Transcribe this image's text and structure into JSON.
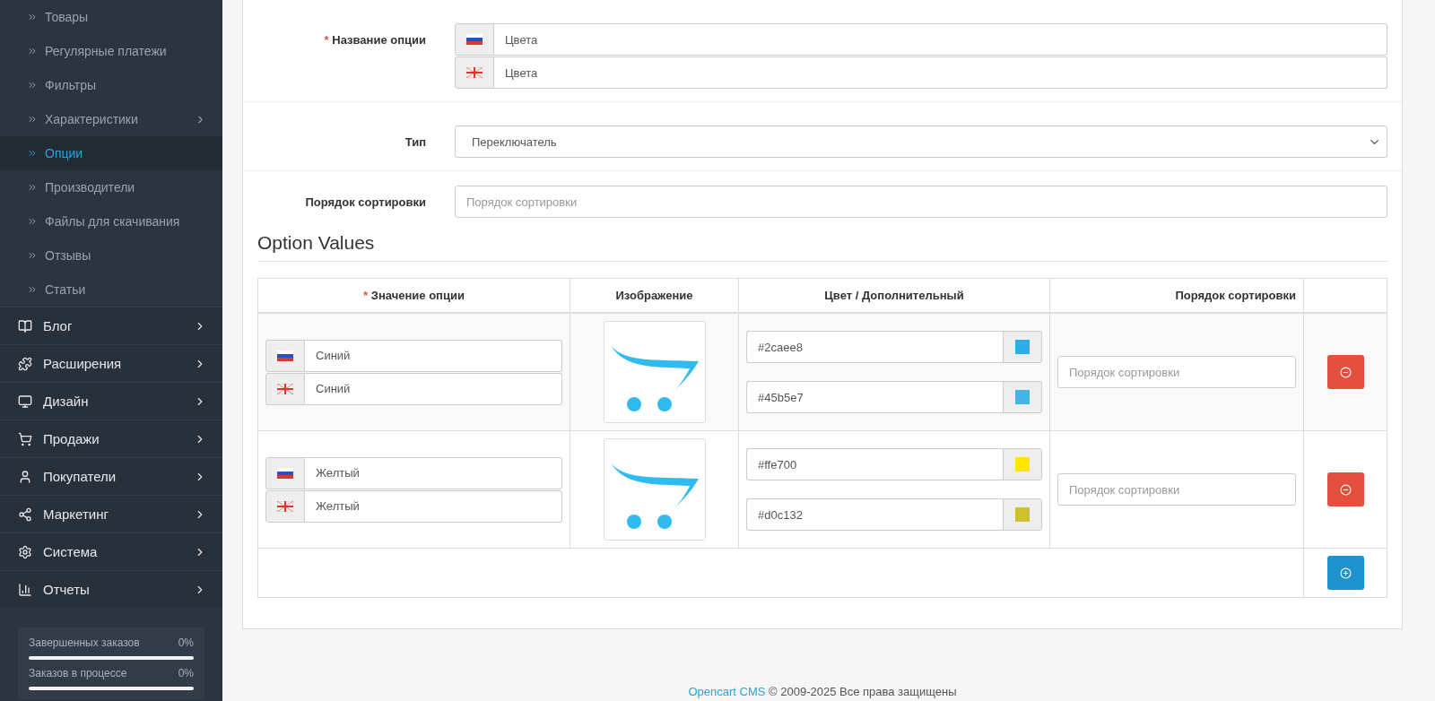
{
  "sidebar": {
    "subitems": [
      {
        "label": "Товары",
        "selected": false,
        "has_children": false
      },
      {
        "label": "Регулярные платежи",
        "selected": false,
        "has_children": false
      },
      {
        "label": "Фильтры",
        "selected": false,
        "has_children": false
      },
      {
        "label": "Характеристики",
        "selected": false,
        "has_children": true
      },
      {
        "label": "Опции",
        "selected": true,
        "has_children": false
      },
      {
        "label": "Производители",
        "selected": false,
        "has_children": false
      },
      {
        "label": "Файлы для скачивания",
        "selected": false,
        "has_children": false
      },
      {
        "label": "Отзывы",
        "selected": false,
        "has_children": false
      },
      {
        "label": "Статьи",
        "selected": false,
        "has_children": false
      }
    ],
    "menu": [
      {
        "label": "Блог",
        "kind": "book"
      },
      {
        "label": "Расширения",
        "kind": "puzzle"
      },
      {
        "label": "Дизайн",
        "kind": "monitor"
      },
      {
        "label": "Продажи",
        "kind": "cart"
      },
      {
        "label": "Покупатели",
        "kind": "user"
      },
      {
        "label": "Маркетинг",
        "kind": "share"
      },
      {
        "label": "Система",
        "kind": "gear"
      },
      {
        "label": "Отчеты",
        "kind": "chart"
      }
    ],
    "stats": [
      {
        "label": "Завершенных заказов",
        "reading": "0%",
        "level": 0
      },
      {
        "label": "Заказов в процессе",
        "reading": "0%",
        "level": 0
      }
    ]
  },
  "form": {
    "name": {
      "label": "Название опции",
      "required_mark": "*",
      "values": [
        {
          "kind": "ru",
          "value": "Цвета"
        },
        {
          "kind": "en",
          "value": "Цвета"
        }
      ]
    },
    "type": {
      "label": "Тип",
      "value": "Переключатель"
    },
    "sort": {
      "label": "Порядок сортировки",
      "placeholder": "Порядок сортировки"
    }
  },
  "option_values": {
    "title": "Option Values",
    "columns": [
      {
        "label": "Значение опции",
        "required_mark": "*"
      },
      {
        "label": "Изображение"
      },
      {
        "label": "Цвет / Дополнительный"
      },
      {
        "label": "Порядок сортировки"
      }
    ],
    "rows": [
      {
        "names": [
          {
            "kind": "ru",
            "value": "Синий"
          },
          {
            "kind": "en",
            "value": "Синий"
          }
        ],
        "colors": [
          {
            "value": "#2caee8",
            "color": "#2caee8"
          },
          {
            "value": "#45b5e7",
            "color": "#45b5e7"
          }
        ],
        "sort_placeholder": "Порядок сортировки"
      },
      {
        "names": [
          {
            "kind": "ru",
            "value": "Желтый"
          },
          {
            "kind": "en",
            "value": "Желтый"
          }
        ],
        "colors": [
          {
            "value": "#ffe700",
            "color": "#ffe700"
          },
          {
            "value": "#d0c132",
            "color": "#d0c132"
          }
        ],
        "sort_placeholder": "Порядок сортировки"
      }
    ]
  },
  "footer": {
    "link": "Opencart CMS",
    "text": "© 2009-2025 Все права защищены"
  }
}
